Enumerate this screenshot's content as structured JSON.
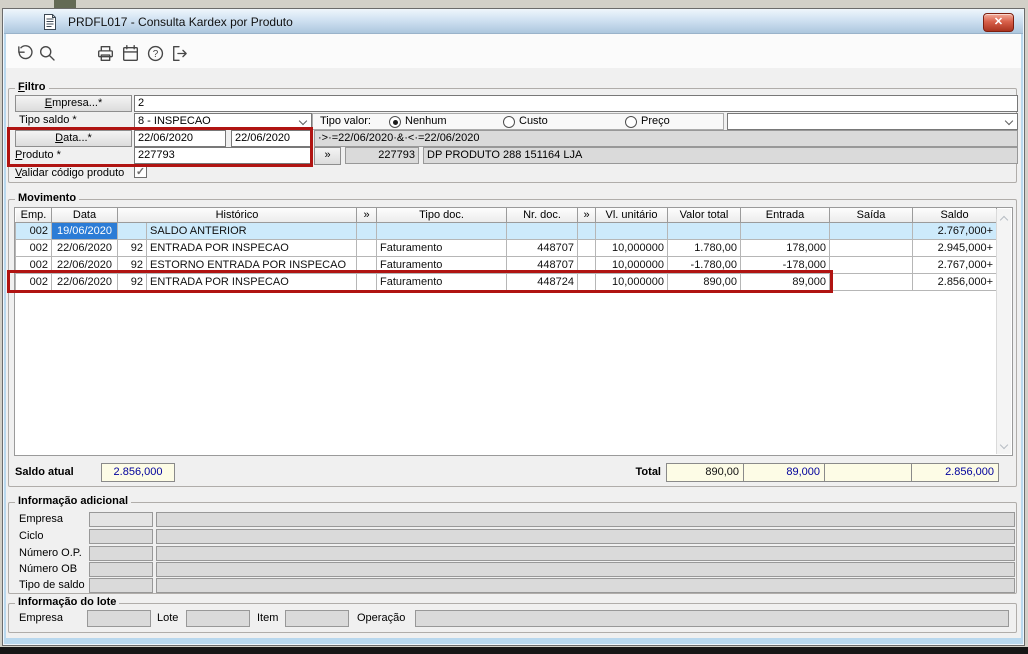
{
  "window": {
    "title": "PRDFL017 - Consulta Kardex por Produto",
    "close_glyph": "✕"
  },
  "toolbar": {
    "buttons": [
      "undo",
      "search",
      "print",
      "calendar",
      "help",
      "exit"
    ]
  },
  "filtro": {
    "legend": "Filtro",
    "empresa_button_label": "Empresa...*",
    "empresa_value": "2",
    "tipo_saldo_label": "Tipo saldo *",
    "tipo_saldo_value": "8 - INSPECAO",
    "tipo_valor_label": "Tipo valor:",
    "tipo_valor_options": [
      {
        "label": "Nenhum",
        "selected": true
      },
      {
        "label": "Custo",
        "selected": false
      },
      {
        "label": "Preço",
        "selected": false
      }
    ],
    "tipo_valor_combo_value": "",
    "data_button_label": "Data...*",
    "data_inicial": "22/06/2020",
    "data_final": "22/06/2020",
    "data_expressao": "·>·=22/06/2020·&·<·=22/06/2020",
    "produto_label": "Produto *",
    "produto_value": "227793",
    "lookup_button_label": "»",
    "produto_codigo": "227793",
    "produto_descricao": "DP PRODUTO 288 151164 LJA",
    "validar_label": "Validar código produto",
    "validar_checked": true,
    "check_glyph": "✓"
  },
  "movimento": {
    "legend": "Movimento",
    "columns": [
      "Emp.",
      "Data",
      "Histórico",
      "»",
      "Tipo doc.",
      "Nr. doc.",
      "»",
      "Vl. unitário",
      "Valor total",
      "Entrada",
      "Saída",
      "Saldo"
    ],
    "rows": [
      {
        "emp": "002",
        "data": "19/06/2020",
        "cod": "",
        "historico": "SALDO ANTERIOR",
        "tipo_doc": "",
        "nr_doc": "",
        "vl_unitario": "",
        "valor_total": "",
        "entrada": "",
        "saida": "",
        "saldo": "2.767,000+"
      },
      {
        "emp": "002",
        "data": "22/06/2020",
        "cod": "92",
        "historico": "ENTRADA POR INSPECAO",
        "tipo_doc": "Faturamento",
        "nr_doc": "448707",
        "vl_unitario": "10,000000",
        "valor_total": "1.780,00",
        "entrada": "178,000",
        "saida": "",
        "saldo": "2.945,000+"
      },
      {
        "emp": "002",
        "data": "22/06/2020",
        "cod": "92",
        "historico": "ESTORNO ENTRADA POR INSPECAO",
        "tipo_doc": "Faturamento",
        "nr_doc": "448707",
        "vl_unitario": "10,000000",
        "valor_total": "-1.780,00",
        "entrada": "-178,000",
        "saida": "",
        "saldo": "2.767,000+"
      },
      {
        "emp": "002",
        "data": "22/06/2020",
        "cod": "92",
        "historico": "ENTRADA POR INSPECAO",
        "tipo_doc": "Faturamento",
        "nr_doc": "448724",
        "vl_unitario": "10,000000",
        "valor_total": "890,00",
        "entrada": "89,000",
        "saida": "",
        "saldo": "2.856,000+"
      }
    ],
    "saldo_atual_label": "Saldo atual",
    "saldo_atual_value": "2.856,000",
    "total_label": "Total",
    "totais": {
      "valor_total": "890,00",
      "entrada": "89,000",
      "saida": "",
      "saldo": "2.856,000"
    }
  },
  "info_adicional": {
    "legend": "Informação adicional",
    "rows": [
      {
        "label": "Empresa",
        "codigo": "",
        "descricao": ""
      },
      {
        "label": "Ciclo",
        "codigo": "",
        "descricao": ""
      },
      {
        "label": "Número O.P.",
        "codigo": "",
        "descricao": ""
      },
      {
        "label": "Número OB",
        "codigo": "",
        "descricao": ""
      },
      {
        "label": "Tipo de saldo",
        "codigo": "",
        "descricao": ""
      }
    ]
  },
  "info_lote": {
    "legend": "Informação do lote",
    "empresa_label": "Empresa",
    "empresa_value": "",
    "lote_label": "Lote",
    "lote_value": "",
    "item_label": "Item",
    "item_value": "",
    "operacao_label": "Operação",
    "operacao_value": ""
  },
  "colors": {
    "highlight_border": "#b01412",
    "prev_balance_row_bg": "#cdeafb",
    "selected_cell_bg": "#2b7cd6",
    "value_text": "#00009c",
    "total_field_bg": "#fdfce6",
    "close_button": "#c24a32"
  }
}
